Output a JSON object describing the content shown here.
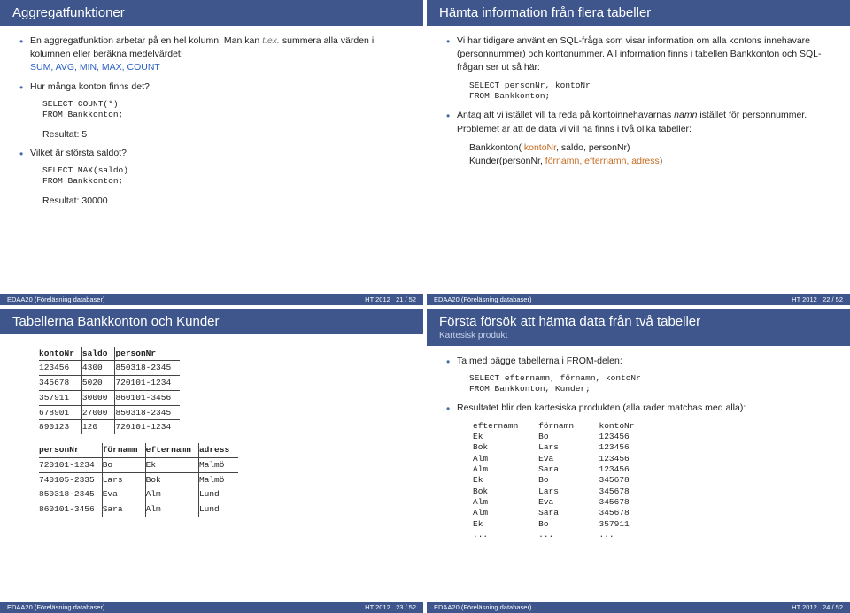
{
  "footer": {
    "left": "EDAA20 (Föreläsning databaser)",
    "mid": "HT 2012"
  },
  "slides": {
    "topLeft": {
      "title": "Aggregatfunktioner",
      "page": "21 / 52",
      "b1_pre": "En aggregatfunktion arbetar på en hel kolumn. Man kan ",
      "b1_tex": "t.ex.",
      "b1_post": " summera alla värden i kolumnen eller beräkna medelvärdet:",
      "kw": "SUM, AVG, MIN, MAX, COUNT",
      "b2": "Hur många konton finns det?",
      "code1": "SELECT COUNT(*)\nFROM Bankkonton;",
      "res1": "Resultat: 5",
      "b3": "Vilket är största saldot?",
      "code2": "SELECT MAX(saldo)\nFROM Bankkonton;",
      "res2": "Resultat: 30000"
    },
    "topRight": {
      "title": "Hämta information från flera tabeller",
      "page": "22 / 52",
      "b1": "Vi har tidigare använt en SQL-fråga som visar information om alla kontons innehavare (personnummer) och kontonummer. All information finns i tabellen Bankkonton och SQL-frågan ser ut så här:",
      "code1": "SELECT personNr, kontoNr\nFROM Bankkonton;",
      "b2a": "Antag att vi istället vill ta reda på kontoinnehavarnas ",
      "b2b": "namn",
      "b2c": " istället för personnummer. Problemet är att de data vi vill ha finns i två olika tabeller:",
      "rel1a": "Bankkonton( ",
      "rel1b": "kontoNr",
      "rel1c": ", saldo, personNr)",
      "rel2a": "Kunder(personNr, ",
      "rel2b": "förnamn, efternamn, adress",
      "rel2c": ")"
    },
    "botLeft": {
      "title": "Tabellerna Bankkonton och Kunder",
      "page": "23 / 52",
      "t1": {
        "h": [
          "kontoNr",
          "saldo",
          "personNr"
        ],
        "r": [
          [
            "123456",
            "4300",
            "850318-2345"
          ],
          [
            "345678",
            "5020",
            "720101-1234"
          ],
          [
            "357911",
            "30000",
            "860101-3456"
          ],
          [
            "678901",
            "27000",
            "850318-2345"
          ],
          [
            "890123",
            "120",
            "720101-1234"
          ]
        ]
      },
      "t2": {
        "h": [
          "personNr",
          "förnamn",
          "efternamn",
          "adress"
        ],
        "r": [
          [
            "720101-1234",
            "Bo",
            "Ek",
            "Malmö"
          ],
          [
            "740105-2335",
            "Lars",
            "Bok",
            "Malmö"
          ],
          [
            "850318-2345",
            "Eva",
            "Alm",
            "Lund"
          ],
          [
            "860101-3456",
            "Sara",
            "Alm",
            "Lund"
          ]
        ]
      }
    },
    "botRight": {
      "title": "Första försök att hämta data från två tabeller",
      "subtitle": "Kartesisk produkt",
      "page": "24 / 52",
      "b1": "Ta med bägge tabellerna i FROM-delen:",
      "code1": "SELECT efternamn, förnamn, kontoNr\nFROM Bankkonton, Kunder;",
      "b2": "Resultatet blir den kartesiska produkten (alla rader matchas med alla):",
      "table": "efternamn    förnamn     kontoNr\nEk           Bo          123456\nBok          Lars        123456\nAlm          Eva         123456\nAlm          Sara        123456\nEk           Bo          345678\nBok          Lars        345678\nAlm          Eva         345678\nAlm          Sara        345678\nEk           Bo          357911\n...          ...         ..."
    }
  }
}
